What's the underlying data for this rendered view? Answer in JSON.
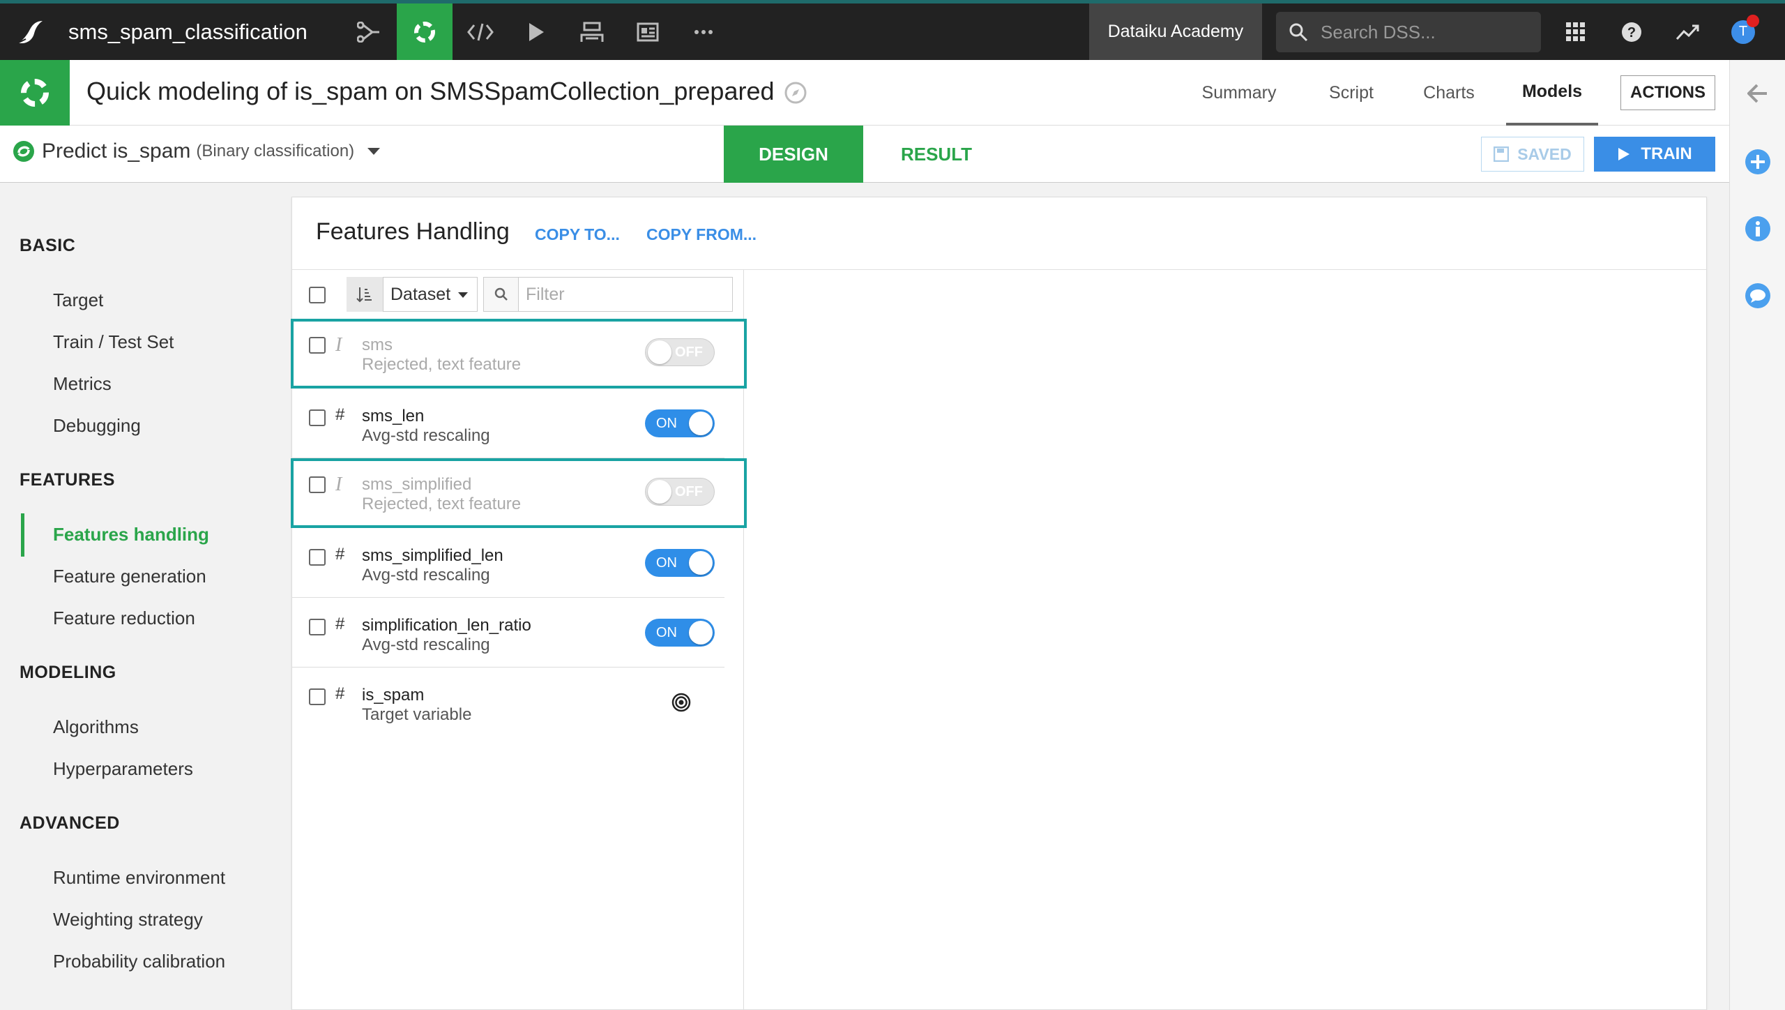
{
  "topnav": {
    "project_name": "sms_spam_classification",
    "academy_label": "Dataiku Academy",
    "search_placeholder": "Search DSS...",
    "avatar_letter": "T"
  },
  "titlebar": {
    "title": "Quick modeling of is_spam on SMSSpamCollection_prepared",
    "tabs": [
      "Summary",
      "Script",
      "Charts",
      "Models"
    ],
    "active_tab": "Models",
    "actions_label": "ACTIONS"
  },
  "subbar": {
    "predict_label": "Predict is_spam",
    "predict_type": "(Binary classification)",
    "design_label": "DESIGN",
    "result_label": "RESULT",
    "saved_label": "SAVED",
    "train_label": "TRAIN"
  },
  "sidebar": {
    "sections": [
      {
        "title": "BASIC",
        "items": [
          "Target",
          "Train / Test Set",
          "Metrics",
          "Debugging"
        ]
      },
      {
        "title": "FEATURES",
        "items": [
          "Features handling",
          "Feature generation",
          "Feature reduction"
        ]
      },
      {
        "title": "MODELING",
        "items": [
          "Algorithms",
          "Hyperparameters"
        ]
      },
      {
        "title": "ADVANCED",
        "items": [
          "Runtime environment",
          "Weighting strategy",
          "Probability calibration"
        ]
      }
    ],
    "active_item": "Features handling"
  },
  "panel": {
    "title": "Features Handling",
    "copy_to": "COPY TO...",
    "copy_from": "COPY FROM...",
    "sort_select": "Dataset",
    "filter_placeholder": "Filter",
    "features": [
      {
        "type": "I",
        "name": "sms",
        "desc": "Rejected, text feature",
        "state": "OFF"
      },
      {
        "type": "#",
        "name": "sms_len",
        "desc": "Avg-std rescaling",
        "state": "ON"
      },
      {
        "type": "I",
        "name": "sms_simplified",
        "desc": "Rejected, text feature",
        "state": "OFF"
      },
      {
        "type": "#",
        "name": "sms_simplified_len",
        "desc": "Avg-std rescaling",
        "state": "ON"
      },
      {
        "type": "#",
        "name": "simplification_len_ratio",
        "desc": "Avg-std rescaling",
        "state": "ON"
      },
      {
        "type": "#",
        "name": "is_spam",
        "desc": "Target variable",
        "state": "target"
      }
    ]
  },
  "colors": {
    "accent_green": "#2aa54a",
    "accent_blue": "#3a8ee6",
    "highlight_teal": "#19a3a3"
  }
}
